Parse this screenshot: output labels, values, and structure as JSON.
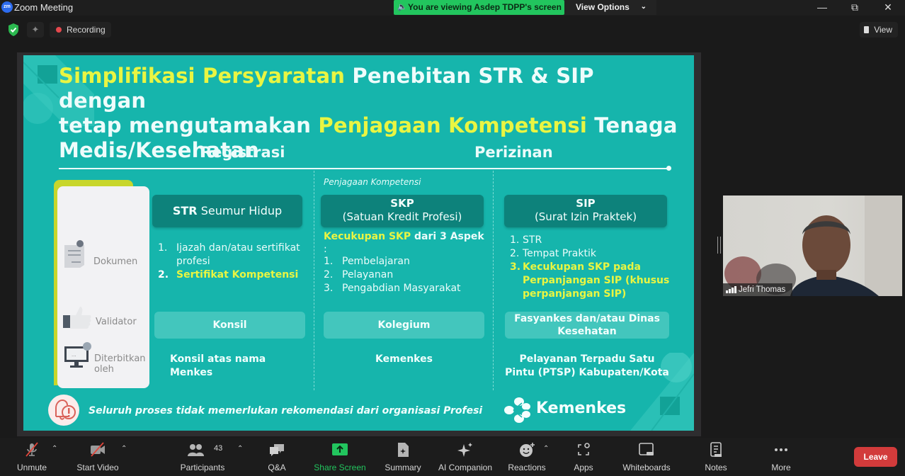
{
  "window": {
    "app_title": "Zoom Meeting",
    "app_logo": "zm",
    "viewing_banner": "You are viewing Asdep TDPP's screen",
    "view_options_label": "View Options",
    "recording_label": "Recording",
    "view_label": "View",
    "controls": [
      "minimize",
      "restore",
      "close"
    ]
  },
  "slide": {
    "title_line1_highlight": "Simplifikasi Persyaratan",
    "title_line1_rest": " Penebitan STR & SIP dengan",
    "title_line2_start": "tetap mengutamakan ",
    "title_line2_highlight": "Penjagaan Kompetensi",
    "title_line2_rest": " Tenaga",
    "title_line3": "Medis/Kesehatan",
    "section_registrasi": "Registrasi",
    "section_perizinan": "Perizinan",
    "penjagaan_label": "Penjagaan Kompetensi",
    "row_labels": {
      "dokumen": "Dokumen",
      "validator": "Validator",
      "diterbitkan_1": "Diterbitkan",
      "diterbitkan_2": "oleh"
    },
    "columns": [
      {
        "header_bold": "STR",
        "header_rest": " Seumur Hidup",
        "documents": [
          {
            "num": "1.",
            "text": "Ijazah dan/atau sertifikat profesi",
            "highlight": false
          },
          {
            "num": "2.",
            "text": "Sertifikat Kompetensi",
            "highlight": true
          }
        ],
        "validator": "Konsil",
        "issuer": "Konsil atas nama Menkes"
      },
      {
        "header_bold": "SKP",
        "header_sub": "(Satuan Kredit Profesi)",
        "intro_highlight": "Kecukupan SKP",
        "intro_rest": " dari 3 Aspek",
        "intro_colon": ":",
        "documents": [
          {
            "num": "1.",
            "text": "Pembelajaran"
          },
          {
            "num": "2.",
            "text": "Pelayanan"
          },
          {
            "num": "3.",
            "text": "Pengabdian Masyarakat"
          }
        ],
        "validator": "Kolegium",
        "issuer": "Kemenkes"
      },
      {
        "header_bold": "SIP",
        "header_sub": "(Surat Izin Praktek)",
        "documents": [
          {
            "num": "1.",
            "text": "STR",
            "highlight": false
          },
          {
            "num": "2.",
            "text": "Tempat Praktik",
            "highlight": false
          },
          {
            "num": "3.",
            "text": "Kecukupan SKP pada Perpanjangan SIP (khusus perpanjangan SIP)",
            "highlight": true
          }
        ],
        "validator": "Fasyankes dan/atau Dinas Kesehatan",
        "issuer": "Pelayanan Terpadu Satu Pintu (PTSP) Kabupaten/Kota"
      }
    ],
    "footer_note": "Seluruh proses tidak memerlukan rekomendasi dari organisasi Profesi",
    "logo_text": "Kemenkes",
    "colors": {
      "background": "#16b5ac",
      "highlight": "#e9f542",
      "dark_box": "#0d827b",
      "light_box": "#43c6bd"
    }
  },
  "video": {
    "participant_name": "Jefri Thomas"
  },
  "toolbar": {
    "unmute": "Unmute",
    "start_video": "Start Video",
    "participants": "Participants",
    "participant_count": "43",
    "qa": "Q&A",
    "share_screen": "Share Screen",
    "summary": "Summary",
    "ai_companion": "AI Companion",
    "reactions": "Reactions",
    "apps": "Apps",
    "whiteboards": "Whiteboards",
    "notes": "Notes",
    "more": "More",
    "leave": "Leave",
    "share_color": "#22c55e",
    "leave_color": "#d23b3b"
  }
}
